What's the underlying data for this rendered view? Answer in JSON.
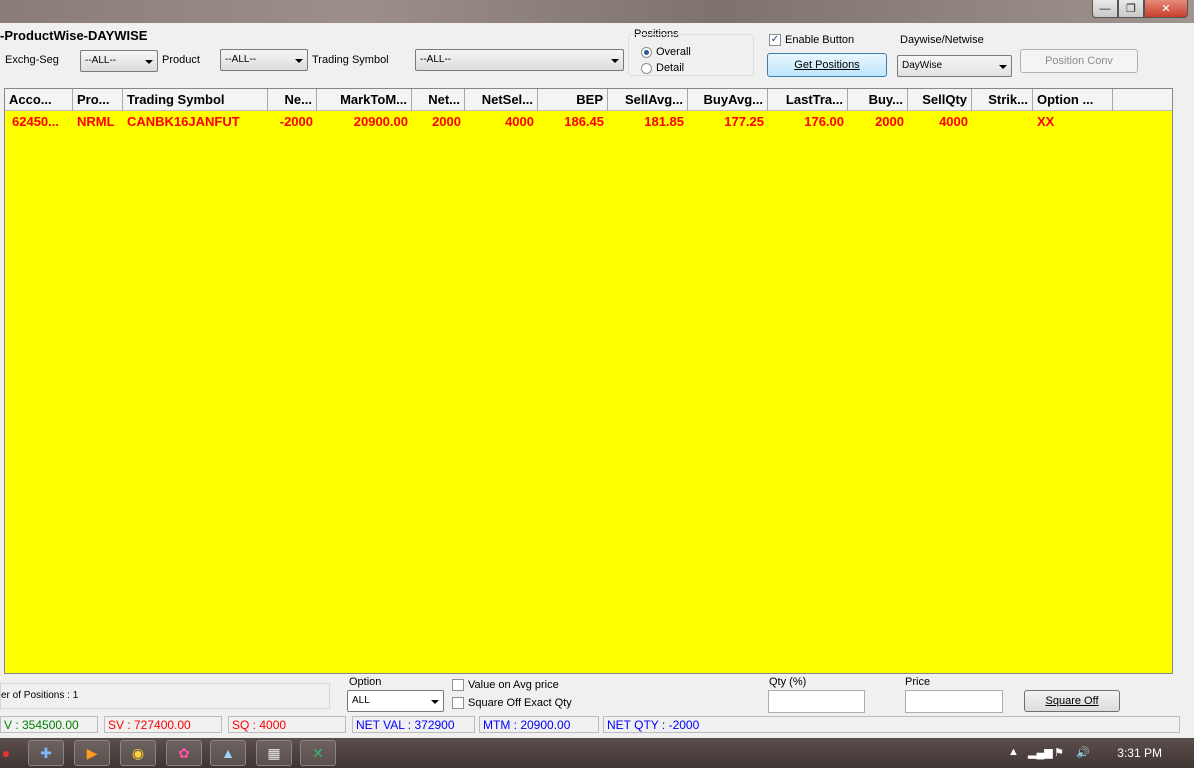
{
  "window": {
    "title": "-ProductWise-DAYWISE",
    "buttons": {
      "minimize": "—",
      "restore": "❐",
      "close": "✕"
    }
  },
  "filters": {
    "exchg_seg_label": "Exchg-Seg",
    "exchg_seg_value": "--ALL--",
    "product_label": "Product",
    "product_value": "--ALL--",
    "trading_symbol_label": "Trading Symbol",
    "trading_symbol_value": "--ALL--"
  },
  "positions": {
    "label": "Positions",
    "options": [
      {
        "label": "Overall",
        "selected": true
      },
      {
        "label": "Detail",
        "selected": false
      }
    ]
  },
  "enable_button": {
    "label": "Enable Button",
    "checked": true
  },
  "get_positions": {
    "label": "Get Positions"
  },
  "daywise": {
    "label": "Daywise/Netwise",
    "value": "DayWise"
  },
  "position_conv": {
    "label": "Position Conv"
  },
  "grid": {
    "columns": [
      "Acco...",
      "Pro...",
      "Trading Symbol",
      "Ne...",
      "MarkToM...",
      "Net...",
      "NetSel...",
      "BEP",
      "SellAvg...",
      "BuyAvg...",
      "LastTra...",
      "Buy...",
      "SellQty",
      "Strik...",
      "Option ..."
    ],
    "rows": [
      [
        "62450...",
        "NRML",
        "CANBK16JANFUT",
        "-2000",
        "20900.00",
        "2000",
        "4000",
        "186.45",
        "181.85",
        "177.25",
        "176.00",
        "2000",
        "4000",
        "",
        "XX"
      ]
    ],
    "background": "#ffff00",
    "text_color": "#ff0000"
  },
  "bottom": {
    "positions_count": "er of Positions : 1",
    "option_label": "Option",
    "option_value": "ALL",
    "value_on_avg": {
      "label": "Value on Avg  price",
      "checked": false
    },
    "square_off_exact": {
      "label": "Square Off Exact Qty",
      "checked": false
    },
    "qty_label": "Qty (%)",
    "qty_value": "",
    "price_label": "Price",
    "price_value": "",
    "square_off_label": "Square Off"
  },
  "status": {
    "bv": "V : 354500.00",
    "sv": "SV : 727400.00",
    "sq": "SQ : 4000",
    "net_val": "NET VAL : 372900",
    "mtm": "MTM : 20900.00",
    "net_qty": "NET QTY : -2000",
    "colors": {
      "bv": "#008000",
      "sv": "#ff0000",
      "sq": "#ff0000",
      "blue": "#0000ff"
    }
  },
  "taskbar": {
    "clock": "3:31 PM",
    "items": [
      "record-icon",
      "puzzle-icon",
      "media-player-icon",
      "chrome-icon",
      "app-icon",
      "prism-icon",
      "calculator-icon",
      "excel-icon"
    ]
  }
}
